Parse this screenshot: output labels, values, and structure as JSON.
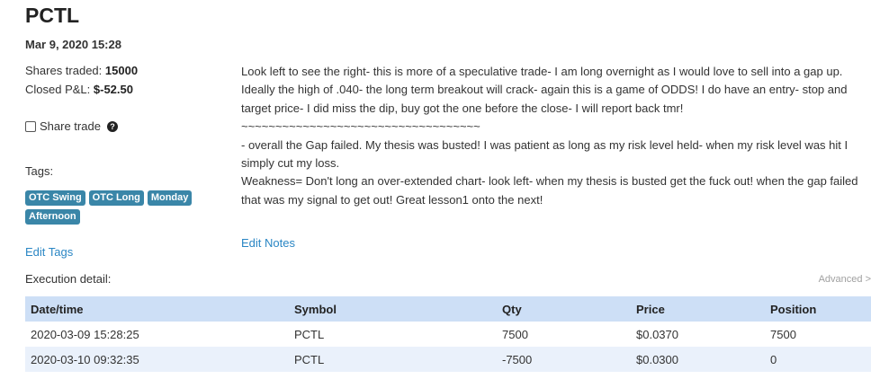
{
  "header": {
    "title": "PCTL",
    "datetime": "Mar 9, 2020 15:28"
  },
  "stats": {
    "shares_label": "Shares traded:",
    "shares_value": "15000",
    "pnl_label": "Closed P&L:",
    "pnl_value": "$-52.50"
  },
  "share_trade": {
    "label": "Share trade",
    "checked": false,
    "help_icon": "question-circle-icon"
  },
  "tags": {
    "label": "Tags:",
    "items": [
      "OTC Swing",
      "OTC Long",
      "Monday",
      "Afternoon"
    ],
    "edit_label": "Edit Tags"
  },
  "notes": {
    "lines": [
      "Look left to see the right- this is more of a speculative trade- I am long overnight as I would love to sell into a gap up. Ideally the high of .040- the long term breakout will crack- again this is a game of ODDS! I do have an entry- stop and target price- I did miss the dip, buy got the one before the close- I will report back tmr!",
      "~~~~~~~~~~~~~~~~~~~~~~~~~~~~~~~~~~~",
      "- overall the Gap failed. My thesis was busted! I was patient as long as my risk level held- when my risk level was hit I simply cut my loss.",
      "Weakness= Don't long an over-extended chart- look left- when my thesis is busted get the fuck out! when the gap failed that was my signal to get out! Great lesson1 onto the next!"
    ],
    "edit_label": "Edit Notes"
  },
  "execution": {
    "label": "Execution detail:",
    "advanced_label": "Advanced >",
    "columns": [
      "Date/time",
      "Symbol",
      "Qty",
      "Price",
      "Position"
    ],
    "rows": [
      [
        "2020-03-09 15:28:25",
        "PCTL",
        "7500",
        "$0.0370",
        "7500"
      ],
      [
        "2020-03-10 09:32:35",
        "PCTL",
        "-7500",
        "$0.0300",
        "0"
      ]
    ]
  },
  "colors": {
    "tag_bg": "#3a86a8",
    "link": "#2a86c4",
    "table_header_bg": "#cddff6",
    "table_alt_row_bg": "#eaf1fb"
  }
}
